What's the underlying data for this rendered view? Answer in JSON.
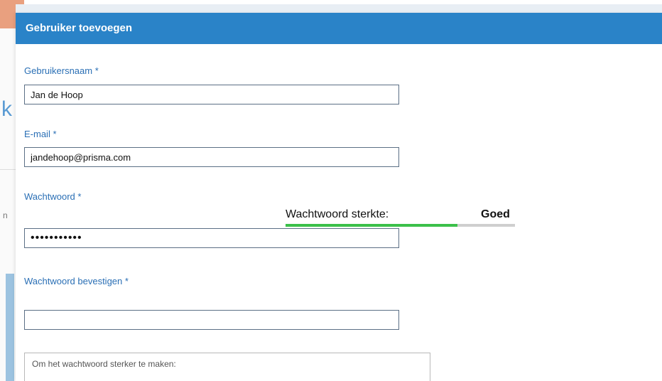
{
  "dialog": {
    "title": "Gebruiker toevoegen"
  },
  "form": {
    "username": {
      "label": "Gebruikersnaam *",
      "value": "Jan de Hoop"
    },
    "email": {
      "label": "E-mail *",
      "value": "jandehoop@prisma.com"
    },
    "password": {
      "label": "Wachtwoord *",
      "value": "•••••••••••"
    },
    "confirm_password": {
      "label": "Wachtwoord bevestigen *",
      "value": ""
    }
  },
  "password_strength": {
    "label": "Wachtwoord sterkte:",
    "value": "Goed",
    "level_fraction": 0.75,
    "fill_color": "#3cc04a"
  },
  "hint": {
    "text": "Om het wachtwoord sterker te maken:"
  },
  "background": {
    "partial_letter_1": "k",
    "partial_letter_2": "n"
  },
  "colors": {
    "header": "#2a83c8",
    "label": "#2a6fb5"
  }
}
